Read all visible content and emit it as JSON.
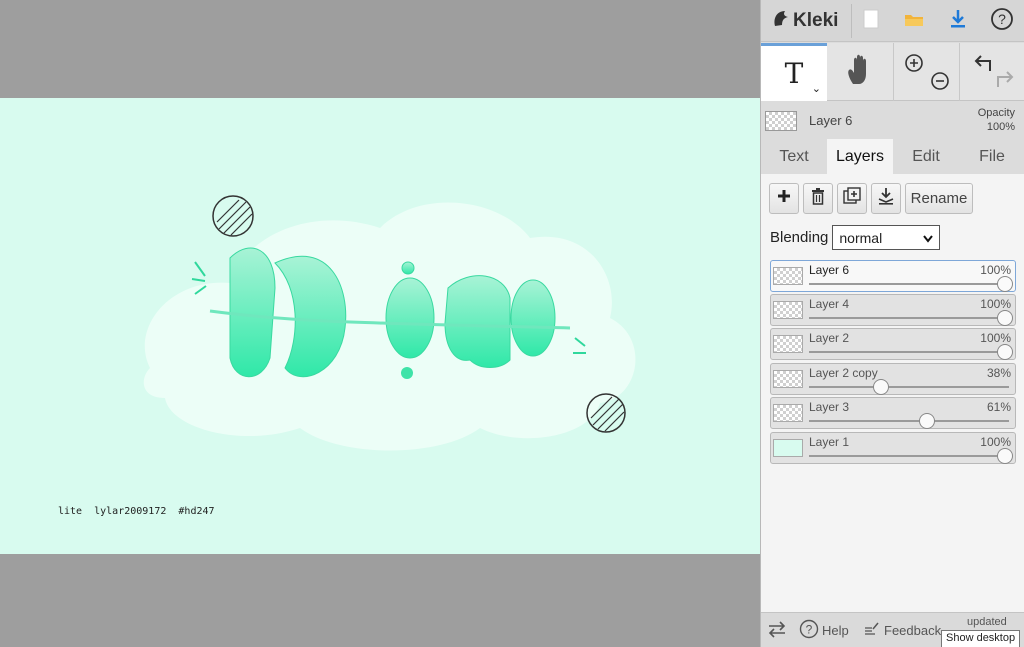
{
  "app": {
    "name": "Kleki"
  },
  "canvas": {
    "credit": "lite  lylar2009172  #hd247",
    "background": "#d8fbef"
  },
  "toolbar": {
    "tool_text": "T"
  },
  "current_layer": {
    "name": "Layer 6",
    "opacity_label": "Opacity",
    "opacity_value": "100%"
  },
  "tabs": [
    {
      "label": "Text"
    },
    {
      "label": "Layers"
    },
    {
      "label": "Edit"
    },
    {
      "label": "File"
    }
  ],
  "layer_actions": {
    "rename_label": "Rename"
  },
  "blending": {
    "label": "Blending",
    "value": "normal"
  },
  "layers": [
    {
      "name": "Layer 6",
      "opacity": "100%",
      "level": 1.0,
      "selected": true
    },
    {
      "name": "Layer 4",
      "opacity": "100%",
      "level": 1.0
    },
    {
      "name": "Layer 2",
      "opacity": "100%",
      "level": 1.0
    },
    {
      "name": "Layer 2 copy",
      "opacity": "38%",
      "level": 0.38
    },
    {
      "name": "Layer 3",
      "opacity": "61%",
      "level": 0.61
    },
    {
      "name": "Layer 1",
      "opacity": "100%",
      "level": 1.0
    }
  ],
  "bottombar": {
    "help": "Help",
    "feedback": "Feedback",
    "updated": "updated",
    "tooltip": "Show desktop"
  }
}
